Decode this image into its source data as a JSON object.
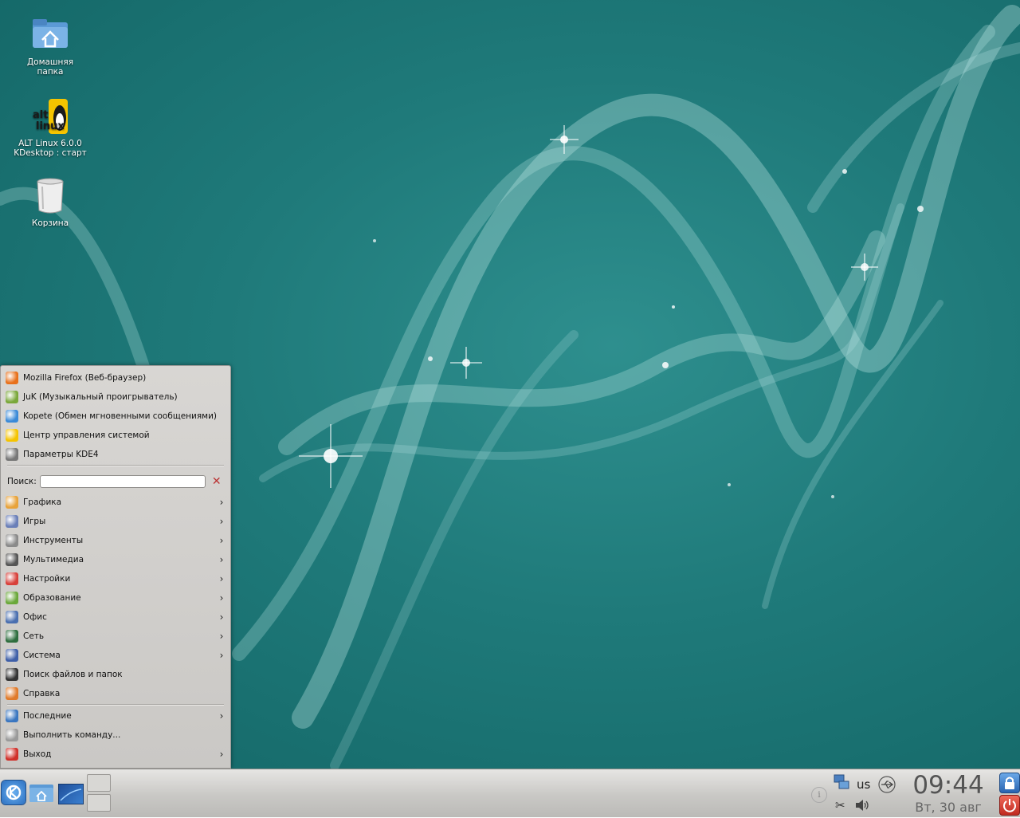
{
  "desktop": {
    "icons": [
      {
        "label_1": "Домашняя",
        "label_2": "папка"
      },
      {
        "label_1": "ALT Linux 6.0.0",
        "label_2": "KDesktop : старт"
      },
      {
        "label_1": "Корзина"
      }
    ]
  },
  "menu": {
    "favorites": [
      {
        "label": "Mozilla Firefox (Веб-браузер)",
        "icon": "firefox-icon"
      },
      {
        "label": "JuK (Музыкальный проигрыватель)",
        "icon": "juk-icon"
      },
      {
        "label": "Kopete (Обмен мгновенными сообщениями)",
        "icon": "kopete-icon"
      },
      {
        "label": "Центр управления системой",
        "icon": "altlinux-icon"
      },
      {
        "label": "Параметры KDE4",
        "icon": "settings-tools-icon"
      }
    ],
    "search": {
      "label": "Поиск:",
      "value": ""
    },
    "categories": [
      {
        "label": "Графика",
        "icon": "graphics-icon",
        "color": "#e8a33a"
      },
      {
        "label": "Игры",
        "icon": "games-icon",
        "color": "#6a7fb8"
      },
      {
        "label": "Инструменты",
        "icon": "tools-icon",
        "color": "#8a8a8a"
      },
      {
        "label": "Мультимедиа",
        "icon": "multimedia-icon",
        "color": "#555555"
      },
      {
        "label": "Настройки",
        "icon": "settings-icon",
        "color": "#d8403a"
      },
      {
        "label": "Образование",
        "icon": "education-icon",
        "color": "#6aa83a"
      },
      {
        "label": "Офис",
        "icon": "office-icon",
        "color": "#4a6fb0"
      },
      {
        "label": "Сеть",
        "icon": "network-icon",
        "color": "#2e6e3e"
      },
      {
        "label": "Система",
        "icon": "system-icon",
        "color": "#3e5fa8"
      }
    ],
    "plain_items": [
      {
        "label": "Поиск файлов и папок",
        "icon": "binoculars-icon",
        "color": "#333333"
      },
      {
        "label": "Справка",
        "icon": "help-icon",
        "color": "#e07a2a"
      }
    ],
    "bottom": [
      {
        "label": "Последние",
        "icon": "recent-icon",
        "color": "#3a76c0",
        "arrow": true
      },
      {
        "label": "Выполнить команду...",
        "icon": "run-icon",
        "color": "#9a9a9a",
        "arrow": false
      },
      {
        "label": "Выход",
        "icon": "logout-icon",
        "color": "#d0302a",
        "arrow": true
      }
    ],
    "arrow": "›"
  },
  "taskbar": {
    "keyboard_layout": "us",
    "time": "09:44",
    "date": "Вт, 30 авг"
  }
}
